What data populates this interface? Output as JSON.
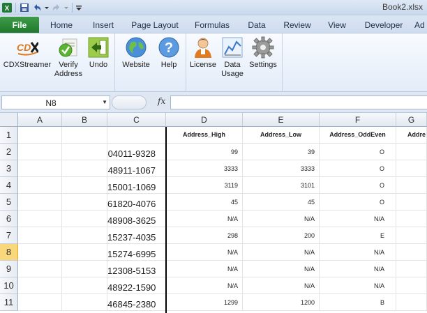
{
  "window": {
    "title": "Book2.xlsx"
  },
  "quick_access": {
    "icons": [
      "excel-icon",
      "save-icon",
      "undo-icon",
      "redo-icon",
      "customize-icon"
    ]
  },
  "tabs": [
    {
      "label": "File"
    },
    {
      "label": "Home"
    },
    {
      "label": "Insert"
    },
    {
      "label": "Page Layout"
    },
    {
      "label": "Formulas"
    },
    {
      "label": "Data"
    },
    {
      "label": "Review"
    },
    {
      "label": "View"
    },
    {
      "label": "Developer"
    },
    {
      "label": "Ad"
    }
  ],
  "ribbon": {
    "cdxstreamer": "CDXStreamer",
    "verify_address_1": "Verify",
    "verify_address_2": "Address",
    "undo": "Undo",
    "website": "Website",
    "help": "Help",
    "license": "License",
    "data_usage_1": "Data",
    "data_usage_2": "Usage",
    "settings": "Settings"
  },
  "formula_bar": {
    "name_box": "N8",
    "fx": "fx",
    "formula": ""
  },
  "columns": [
    "A",
    "B",
    "C",
    "D",
    "E",
    "F",
    "G"
  ],
  "rows": [
    "1",
    "2",
    "3",
    "4",
    "5",
    "6",
    "7",
    "8",
    "9",
    "10",
    "11"
  ],
  "active_row": "8",
  "sheet": {
    "headers": {
      "d": "Address_High",
      "e": "Address_Low",
      "f": "Address_OddEven",
      "g": "Addre"
    },
    "data": [
      {
        "zip": "04011-9328",
        "high": "99",
        "low": "39",
        "oe": "O"
      },
      {
        "zip": "48911-1067",
        "high": "3333",
        "low": "3333",
        "oe": "O"
      },
      {
        "zip": "15001-1069",
        "high": "3119",
        "low": "3101",
        "oe": "O"
      },
      {
        "zip": "61820-4076",
        "high": "45",
        "low": "45",
        "oe": "O"
      },
      {
        "zip": "48908-3625",
        "high": "N/A",
        "low": "N/A",
        "oe": "N/A"
      },
      {
        "zip": "15237-4035",
        "high": "298",
        "low": "200",
        "oe": "E"
      },
      {
        "zip": "15274-6995",
        "high": "N/A",
        "low": "N/A",
        "oe": "N/A"
      },
      {
        "zip": "12308-5153",
        "high": "N/A",
        "low": "N/A",
        "oe": "N/A"
      },
      {
        "zip": "48922-1590",
        "high": "N/A",
        "low": "N/A",
        "oe": "N/A"
      },
      {
        "zip": "46845-2380",
        "high": "1299",
        "low": "1200",
        "oe": "B"
      }
    ]
  },
  "colors": {
    "file_tab": "#2a8a37",
    "active_row_header": "#f9d87c",
    "ribbon_bg": "#e3ecf8"
  }
}
